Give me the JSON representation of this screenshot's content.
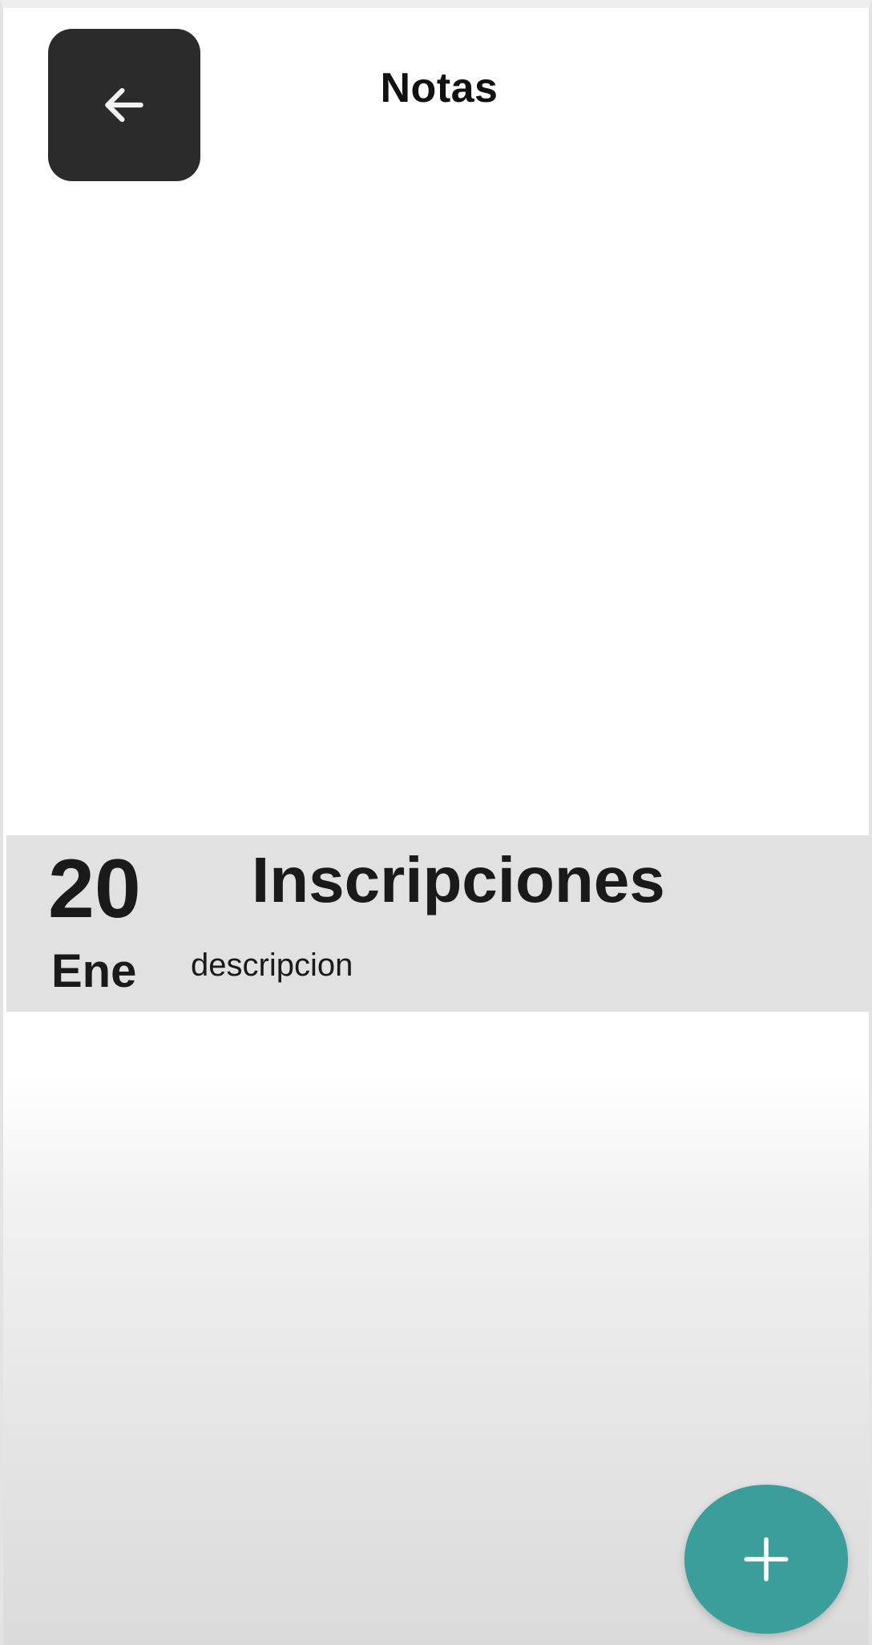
{
  "header": {
    "title": "Notas",
    "back_icon": "arrow-left-icon"
  },
  "notes": [
    {
      "day": "20",
      "month": "Ene",
      "title": "Inscripciones",
      "description": "descripcion"
    }
  ],
  "fab": {
    "icon": "plus-icon",
    "color": "#3a9e9b"
  },
  "colors": {
    "back_button_bg": "#2b2b2b",
    "note_row_bg": "#e1e1e1"
  }
}
